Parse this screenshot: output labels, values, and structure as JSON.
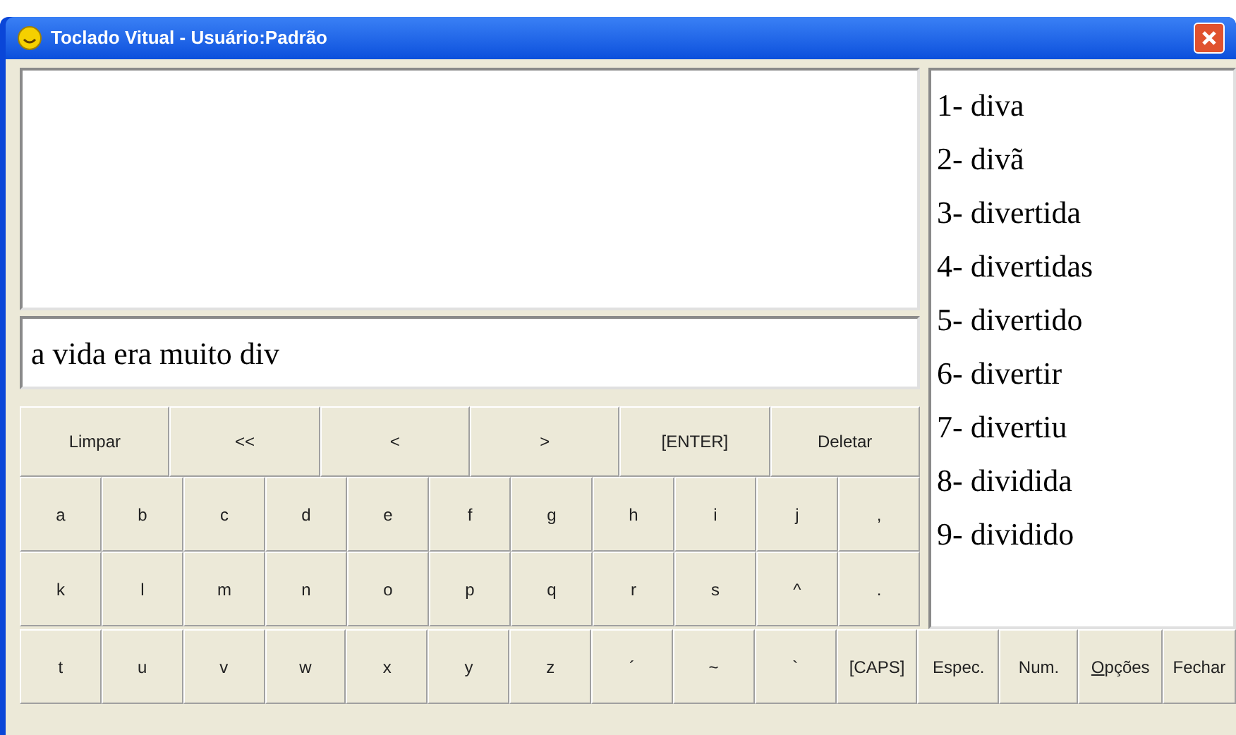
{
  "window": {
    "title": "Toclado Vitual - Usuário:Padrão"
  },
  "input": {
    "value": "a vida era muito div"
  },
  "controls": [
    "Limpar",
    "<<",
    "<",
    ">",
    "[ENTER]",
    "Deletar"
  ],
  "key_rows": [
    [
      "a",
      "b",
      "c",
      "d",
      "e",
      "f",
      "g",
      "h",
      "i",
      "j",
      ","
    ],
    [
      "k",
      "l",
      "m",
      "n",
      "o",
      "p",
      "q",
      "r",
      "s",
      "^",
      "."
    ],
    [
      "t",
      "u",
      "v",
      "w",
      "x",
      "y",
      "z",
      "´",
      "~",
      "`"
    ]
  ],
  "function_buttons": [
    {
      "label": "[CAPS]",
      "underline_first": false
    },
    {
      "label": "Espec.",
      "underline_first": false
    },
    {
      "label": "Num.",
      "underline_first": false
    },
    {
      "label": "Opções",
      "underline_first": true
    },
    {
      "label": "Fechar",
      "underline_first": false
    }
  ],
  "suggestions": [
    "1- diva",
    "2- divã",
    "3- divertida",
    "4- divertidas",
    "5- divertido",
    "6- divertir",
    "7- divertiu",
    "8- dividida",
    "9- dividido"
  ]
}
